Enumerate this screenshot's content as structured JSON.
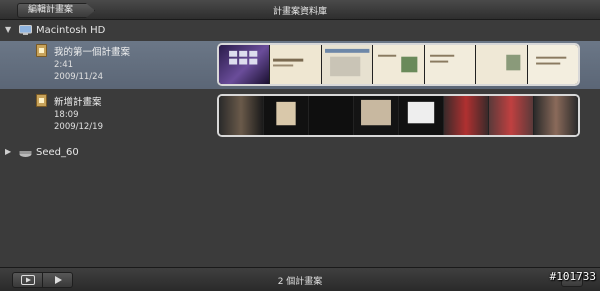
{
  "window": {
    "back_label": "編輯計畫案",
    "title": "計畫案資料庫"
  },
  "disks": [
    {
      "name": "Macintosh HD",
      "expanded": true
    },
    {
      "name": "Seed_60",
      "expanded": false
    }
  ],
  "projects": [
    {
      "name": "我的第一個計畫案",
      "duration": "2:41",
      "date": "2009/11/24",
      "selected": true
    },
    {
      "name": "新增計畫案",
      "duration": "18:09",
      "date": "2009/12/19",
      "selected": false
    }
  ],
  "status": {
    "count_label": "2 個計畫案"
  },
  "watermark": "#101733",
  "colors": {
    "selection": "#65717f",
    "background": "#3b3b3b"
  }
}
